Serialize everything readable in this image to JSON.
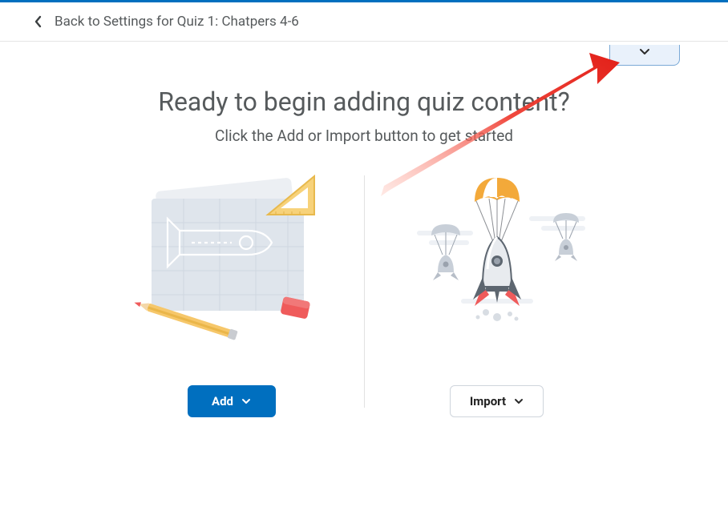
{
  "header": {
    "back_label": "Back to Settings for Quiz 1: Chatpers 4-6"
  },
  "content": {
    "heading": "Ready to begin adding quiz content?",
    "subtitle": "Click the Add or Import button to get started"
  },
  "buttons": {
    "add_label": "Add",
    "import_label": "Import"
  },
  "colors": {
    "accent": "#006fbf",
    "annotation": "#ef3e33"
  }
}
